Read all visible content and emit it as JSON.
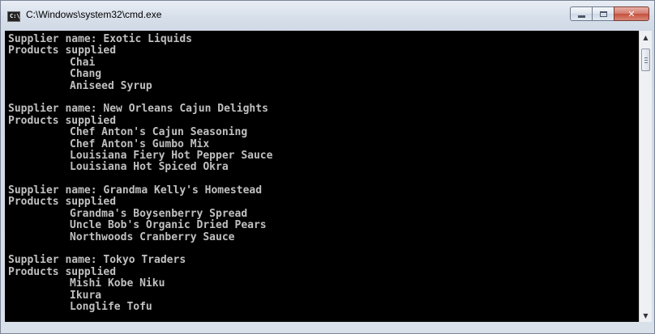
{
  "window": {
    "title": "C:\\Windows\\system32\\cmd.exe",
    "icon_label": "C:\\"
  },
  "buttons": {
    "minimize": "minimize",
    "maximize": "maximize",
    "close": "✕"
  },
  "console": {
    "blocks": [
      {
        "supplier_line": "Supplier name: Exotic Liquids",
        "products_header": "Products supplied",
        "products": [
          "Chai",
          "Chang",
          "Aniseed Syrup"
        ]
      },
      {
        "supplier_line": "Supplier name: New Orleans Cajun Delights",
        "products_header": "Products supplied",
        "products": [
          "Chef Anton's Cajun Seasoning",
          "Chef Anton's Gumbo Mix",
          "Louisiana Fiery Hot Pepper Sauce",
          "Louisiana Hot Spiced Okra"
        ]
      },
      {
        "supplier_line": "Supplier name: Grandma Kelly's Homestead",
        "products_header": "Products supplied",
        "products": [
          "Grandma's Boysenberry Spread",
          "Uncle Bob's Organic Dried Pears",
          "Northwoods Cranberry Sauce"
        ]
      },
      {
        "supplier_line": "Supplier name: Tokyo Traders",
        "products_header": "Products supplied",
        "products": [
          "Mishi Kobe Niku",
          "Ikura",
          "Longlife Tofu"
        ]
      }
    ]
  },
  "colors": {
    "console_bg": "#000000",
    "console_fg": "#c0c0c0"
  }
}
